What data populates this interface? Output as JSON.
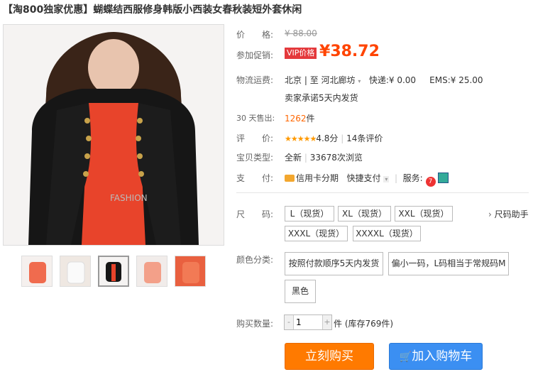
{
  "title": "【淘800独家优惠】蝴蝶结西服修身韩版小西装女春秋装短外套休闲",
  "price": {
    "label": "价　　格:",
    "original": "¥ 88.00",
    "promo_label": "参加促销:",
    "vip_badge": "VIP价格",
    "currency": "¥",
    "promo_price": "38.72"
  },
  "shipping": {
    "label": "物流运费:",
    "from": "北京",
    "separator": "至",
    "to": "河北廊坊",
    "express_label": "快递:",
    "express_fee": "¥ 0.00",
    "ems_label": "EMS:",
    "ems_fee": "¥ 25.00",
    "note": "卖家承诺5天内发货"
  },
  "sales": {
    "label": "30 天售出:",
    "count": "1262",
    "unit": "件"
  },
  "rating": {
    "label": "评　　价:",
    "stars": "★★★★★",
    "score": "4.8分",
    "reviews": "14条评价"
  },
  "item_type": {
    "label": "宝贝类型:",
    "condition": "全新",
    "views": "33678次浏览"
  },
  "payment": {
    "label": "支　　付:",
    "credit": "信用卡分期",
    "quick_pay": "快捷支付",
    "service_label": "服务:"
  },
  "size": {
    "label": "尺　　码:",
    "options": [
      "L（现货）",
      "XL（现货）",
      "XXL（现货）",
      "XXXL（现货）",
      "XXXXL（现货）"
    ],
    "helper": "尺码助手"
  },
  "color": {
    "label": "颜色分类:",
    "options": [
      "按照付款顺序5天内发货",
      "偏小一码，L码相当于常规码M",
      "黑色"
    ]
  },
  "quantity": {
    "label": "购买数量:",
    "value": "1",
    "unit": "件",
    "stock": "(库存769件)"
  },
  "actions": {
    "buy": "立刻购买",
    "cart": "加入购物车"
  },
  "image_watermark": "FASHION",
  "colors": {
    "accent_price": "#ff4400",
    "buy_button": "#ff7a00",
    "cart_button": "#3b8ff2"
  }
}
